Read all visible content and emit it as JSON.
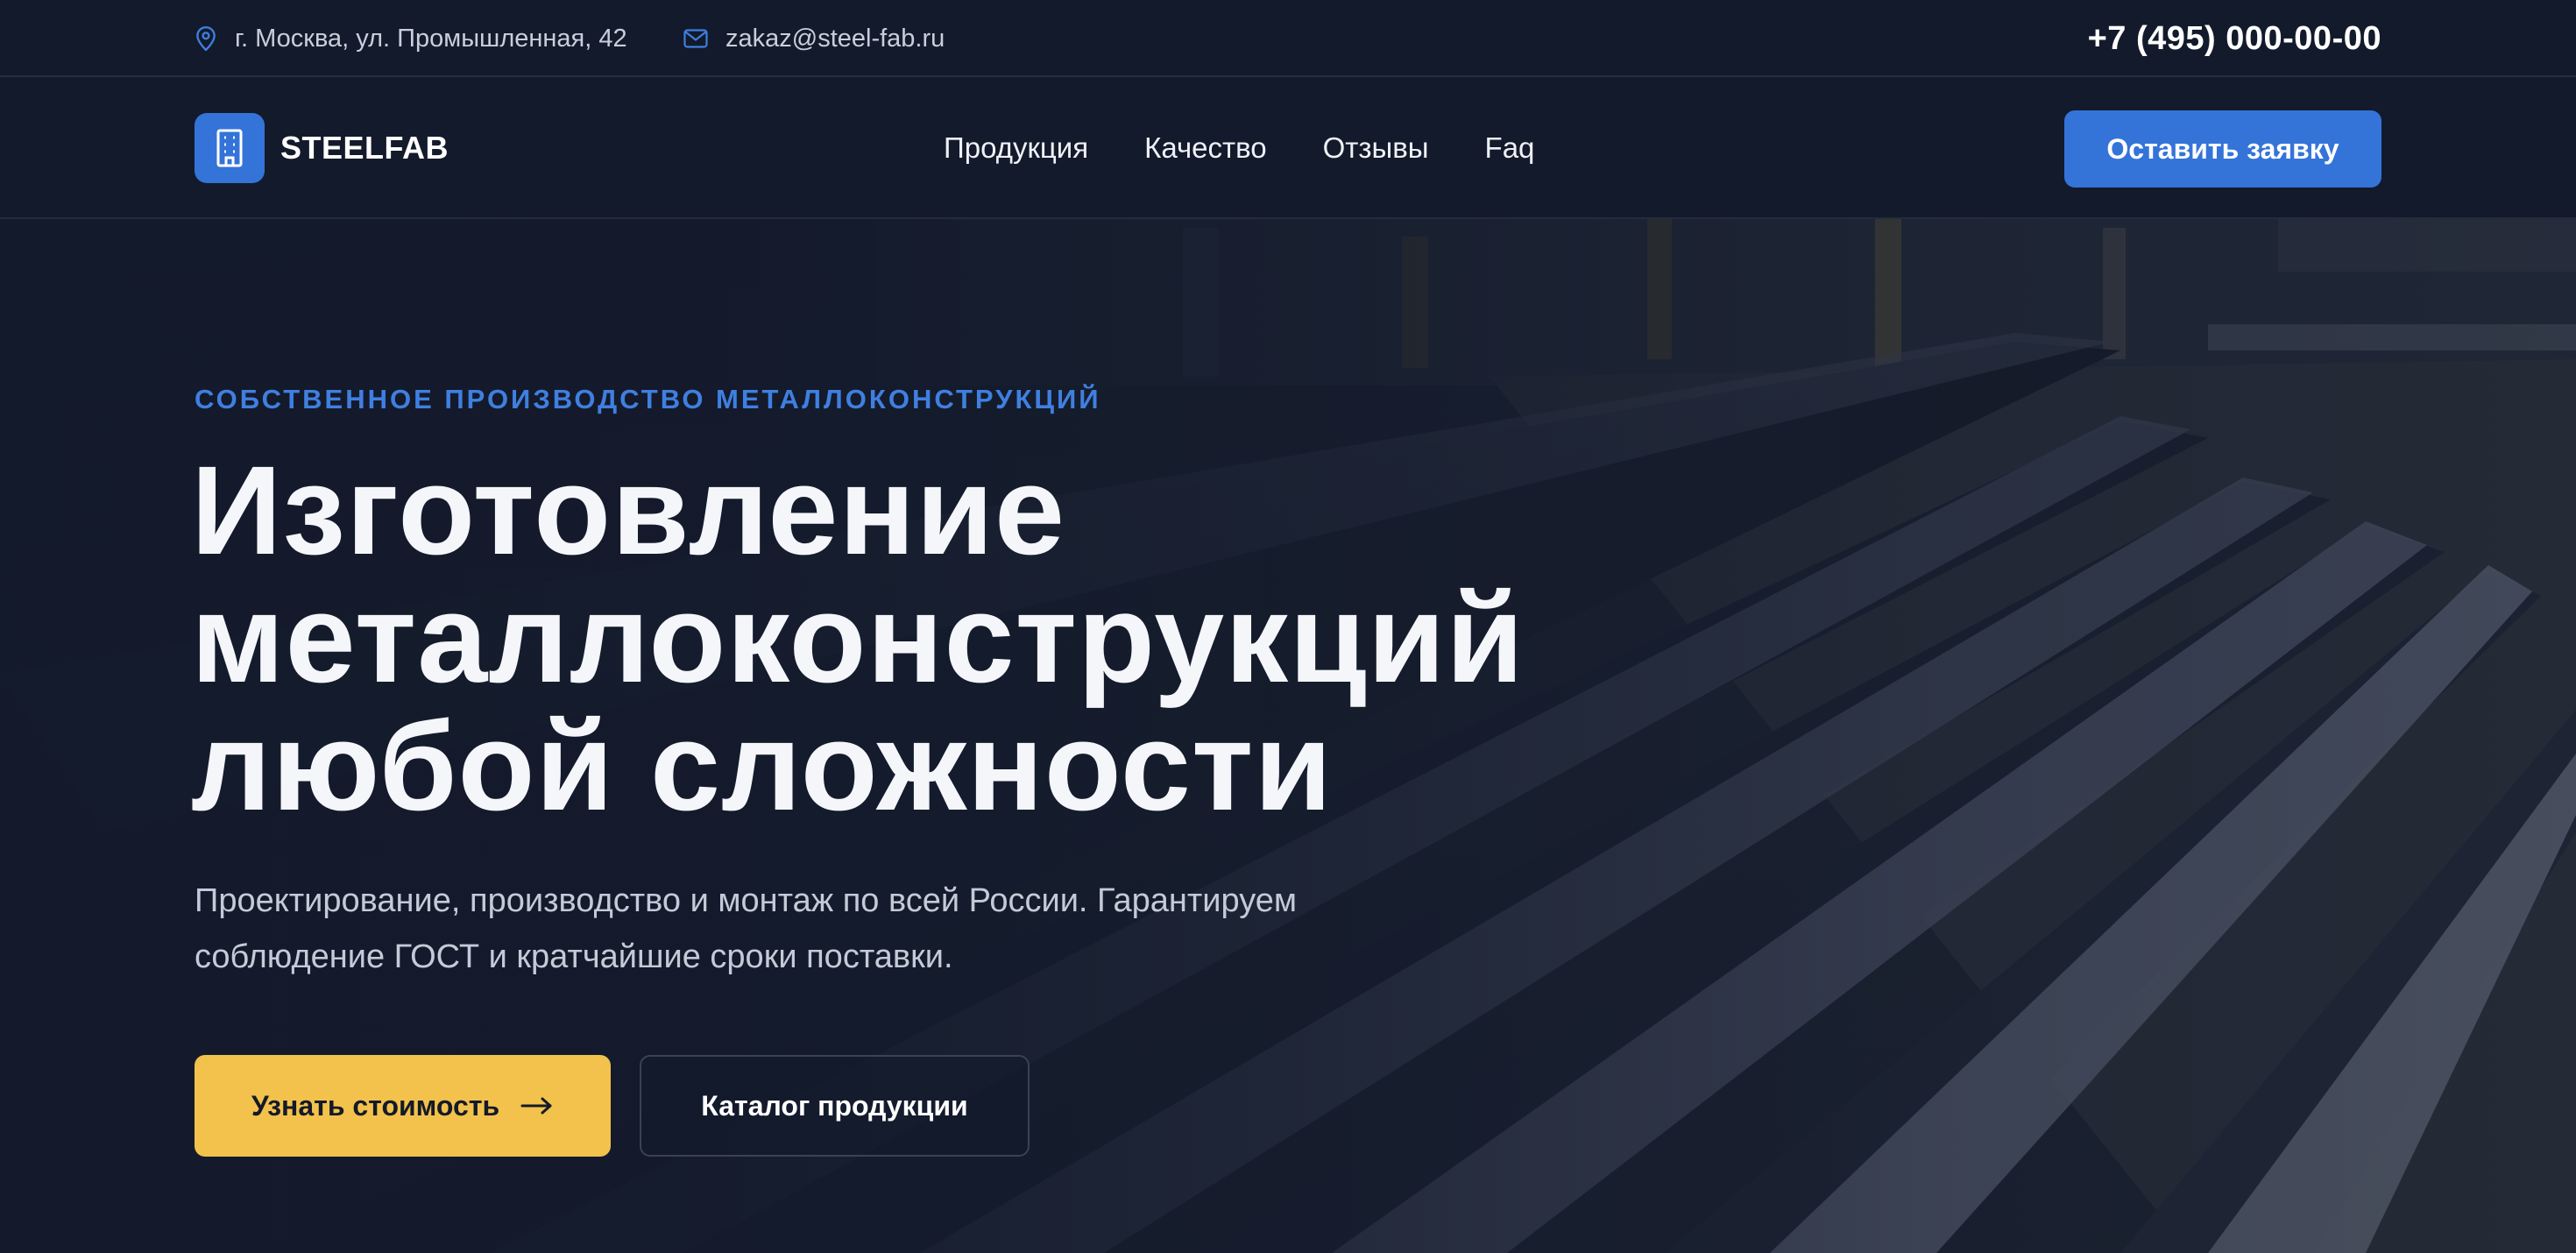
{
  "topbar": {
    "address": "г. Москва, ул. Промышленная, 42",
    "address_icon": "map-pin-icon",
    "email": "zakaz@steel-fab.ru",
    "email_icon": "mail-icon",
    "phone": "+7 (495) 000-00-00"
  },
  "header": {
    "logo_icon": "building-icon",
    "logo_text": "STEELFAB",
    "nav": [
      "Продукция",
      "Качество",
      "Отзывы",
      "Faq"
    ],
    "cta_label": "Оставить заявку"
  },
  "hero": {
    "eyebrow": "СОБСТВЕННОЕ ПРОИЗВОДСТВО МЕТАЛЛОКОНСТРУКЦИЙ",
    "headline_lines": [
      "Изготовление",
      "металлоконструкций",
      "любой сложности"
    ],
    "subtitle_lines": [
      "Проектирование, производство и монтаж по всей России. Гарантируем",
      "соблюдение ГОСТ и кратчайшие сроки поставки."
    ],
    "primary_button": "Узнать стоимость",
    "primary_button_icon": "arrow-right-icon",
    "secondary_button": "Каталог продукции"
  },
  "colors": {
    "background": "#131a2b",
    "accent_blue": "#3474d9",
    "accent_yellow": "#f2c24c",
    "text_light": "#f4f6fa"
  }
}
